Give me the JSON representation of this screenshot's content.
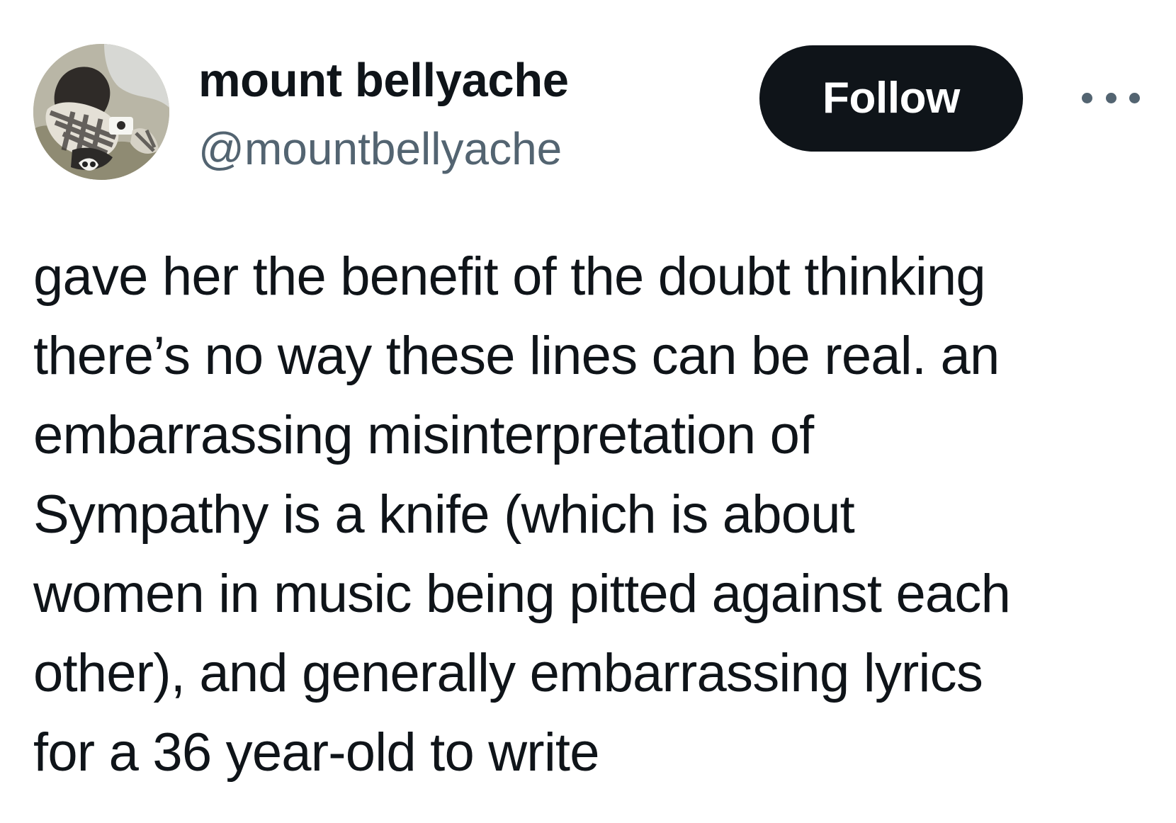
{
  "author": {
    "display_name": "mount bellyache",
    "handle": "@mountbellyache",
    "avatar_icon": "profile-photo"
  },
  "actions": {
    "follow_label": "Follow",
    "more_icon": "more-horizontal-icon"
  },
  "tweet": {
    "lines": [
      "gave her the benefit of the doubt thinking",
      "there’s no way these lines can be real. an",
      "embarrassing misinterpretation of",
      "Sympathy is a knife (which is about",
      "women in music being pitted against each",
      "other), and generally embarrassing lyrics",
      "for a 36 year-old to write"
    ]
  },
  "colors": {
    "text_primary": "#0f1419",
    "text_secondary": "#536471",
    "button_background": "#0f1419",
    "button_text": "#ffffff",
    "background": "#ffffff"
  }
}
